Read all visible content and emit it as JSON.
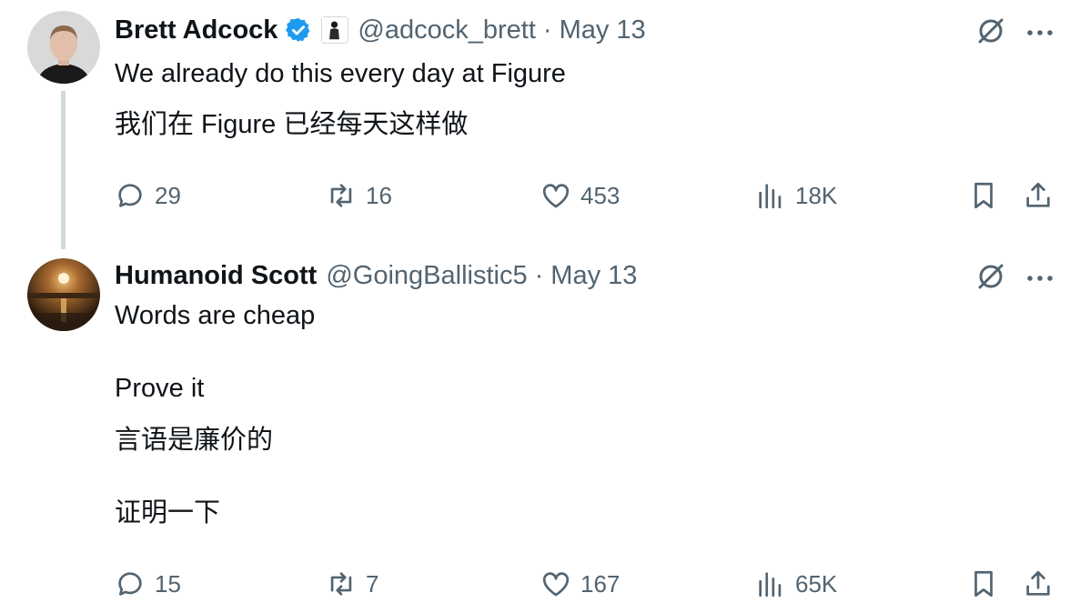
{
  "tweets": [
    {
      "author": {
        "name": "Brett Adcock",
        "handle": "@adcock_brett",
        "verified": true,
        "affiliate_badge": "figure-logo"
      },
      "separator": "·",
      "date": "May 13",
      "text_lines": [
        "We already do this every day at Figure",
        "我们在 Figure 已经每天这样做"
      ],
      "stats": {
        "replies": "29",
        "reposts": "16",
        "likes": "453",
        "views": "18K"
      }
    },
    {
      "author": {
        "name": "Humanoid Scott",
        "handle": "@GoingBallistic5",
        "verified": false
      },
      "separator": "·",
      "date": "May 13",
      "text_lines": [
        "Words are cheap",
        "Prove it",
        "言语是廉价的",
        "证明一下"
      ],
      "stats": {
        "replies": "15",
        "reposts": "7",
        "likes": "167",
        "views": "65K"
      }
    }
  ],
  "colors": {
    "text": "#0f1419",
    "secondary": "#536471",
    "verified_blue": "#1d9bf0",
    "thread_line": "#cfd9de"
  },
  "icons": {
    "top": [
      "grok-icon",
      "more-icon"
    ],
    "actions": [
      "reply-icon",
      "repost-icon",
      "like-icon",
      "views-icon",
      "bookmark-icon",
      "share-icon"
    ]
  }
}
